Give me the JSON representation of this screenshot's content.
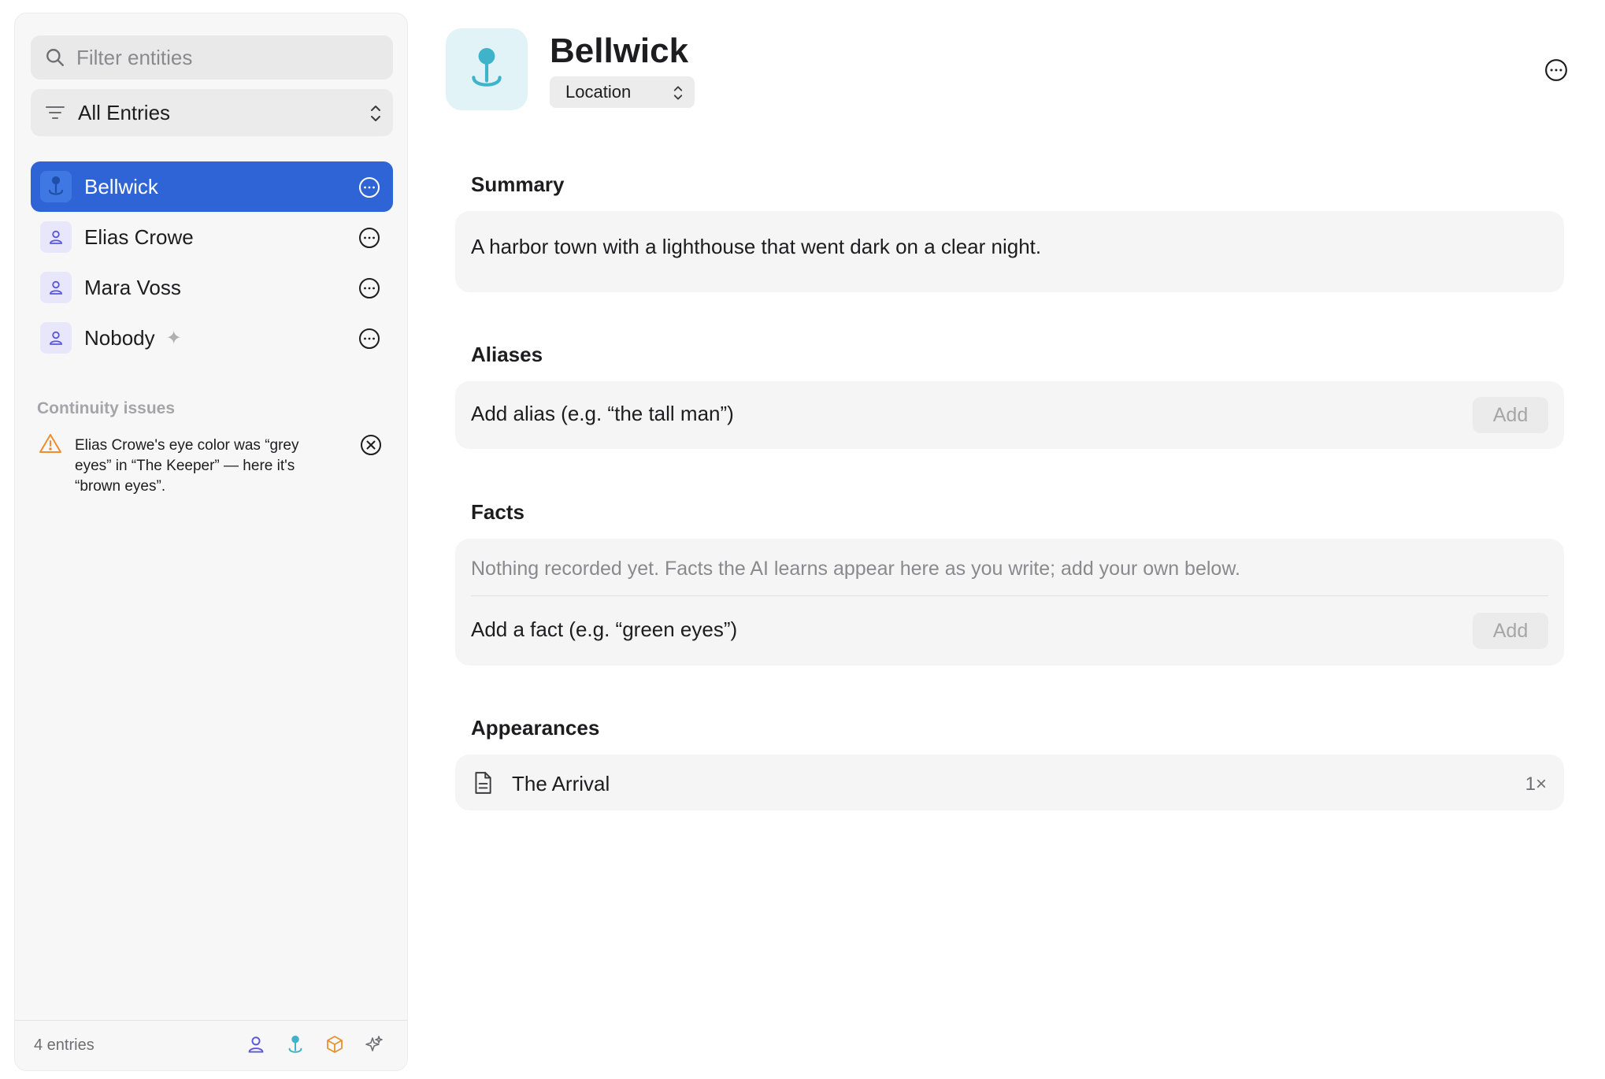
{
  "sidebar": {
    "search_placeholder": "Filter entities",
    "filter_label": "All Entries",
    "entities": [
      {
        "name": "Bellwick",
        "type": "location",
        "selected": true
      },
      {
        "name": "Elias Crowe",
        "type": "person"
      },
      {
        "name": "Mara Voss",
        "type": "person"
      },
      {
        "name": "Nobody",
        "type": "person",
        "ai_badge": "✦"
      }
    ],
    "continuity": {
      "title": "Continuity issues",
      "issues": [
        {
          "text": "Elias Crowe's eye color was “grey eyes” in “The Keeper” — here it's “brown eyes”."
        }
      ]
    },
    "footer": {
      "count": "4 entries",
      "icons": [
        "person-icon",
        "location-pin-icon",
        "object-box-icon",
        "sparkles-icon"
      ]
    }
  },
  "entity": {
    "title": "Bellwick",
    "type": "Location",
    "icon": "location-pin-icon"
  },
  "summary": {
    "title": "Summary",
    "text": "A harbor town with a lighthouse that went dark on a clear night."
  },
  "aliases": {
    "title": "Aliases",
    "placeholder": "Add alias (e.g. “the tall man”)",
    "add_label": "Add"
  },
  "facts": {
    "title": "Facts",
    "empty_text": "Nothing recorded yet. Facts the AI learns appear here as you write; add your own below.",
    "placeholder": "Add a fact (e.g. “green eyes”)",
    "add_label": "Add"
  },
  "appearances": {
    "title": "Appearances",
    "items": [
      {
        "name": "The Arrival",
        "count": "1×"
      }
    ]
  },
  "colors": {
    "accent": "#2f64d6",
    "location": "#3fb3c9",
    "person": "#5b57d9",
    "object": "#e8912d",
    "warning": "#f08c2e"
  }
}
